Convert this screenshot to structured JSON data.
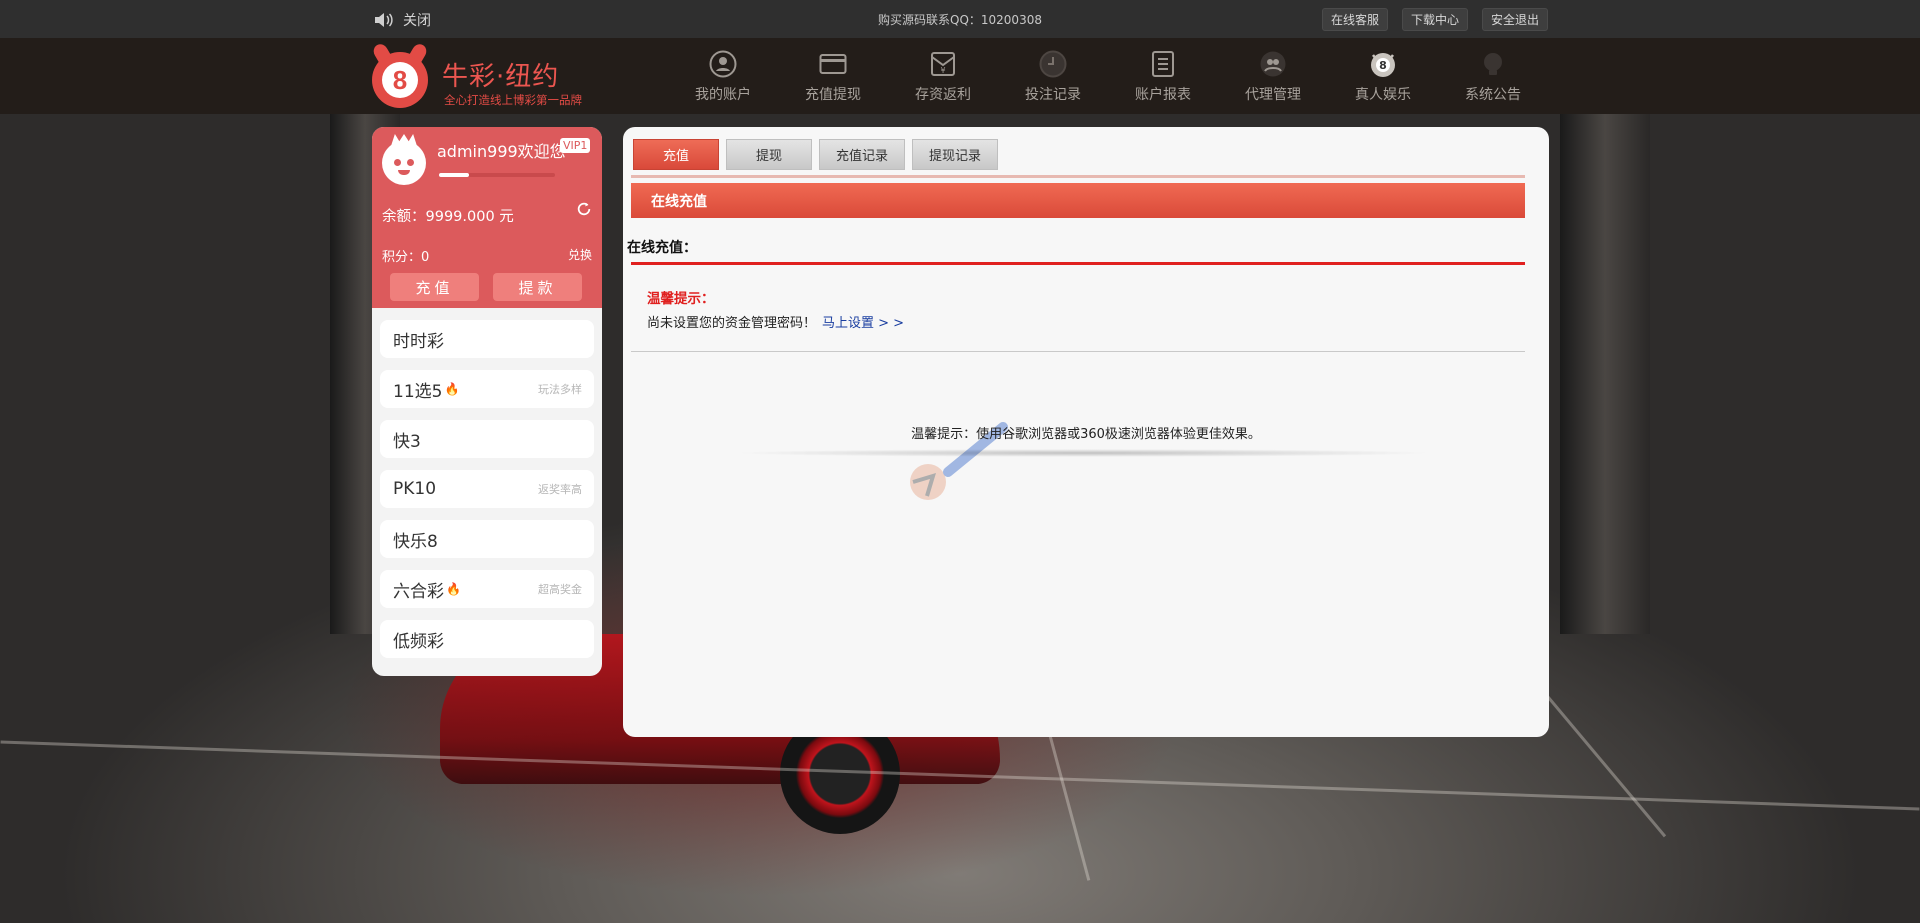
{
  "topbar": {
    "sound_label": "关闭",
    "contact": "购买源码联系QQ：10200308",
    "links": [
      "在线客服",
      "下载中心",
      "安全退出"
    ]
  },
  "logo": {
    "ball_digit": "8",
    "name": "牛彩·纽约",
    "slogan": "全心打造线上博彩第一品牌"
  },
  "nav": [
    {
      "label": "我的账户",
      "icon": "user-icon"
    },
    {
      "label": "充值提现",
      "icon": "card-icon"
    },
    {
      "label": "存资返利",
      "icon": "yen-envelope-icon"
    },
    {
      "label": "投注记录",
      "icon": "clock-icon"
    },
    {
      "label": "账户报表",
      "icon": "report-icon"
    },
    {
      "label": "代理管理",
      "icon": "agent-icon"
    },
    {
      "label": "真人娱乐",
      "icon": "eight-ball-icon"
    },
    {
      "label": "系统公告",
      "icon": "bulb-icon"
    }
  ],
  "user": {
    "welcome": "admin999欢迎您",
    "vip": "VIP1",
    "progress": 0.26,
    "balance": "余额：9999.000 元",
    "points": "积分：0",
    "exchange": "兑换",
    "deposit_button": "充值",
    "withdraw_button": "提款"
  },
  "games": [
    {
      "name": "时时彩",
      "tag": "",
      "hot": false
    },
    {
      "name": "11选5",
      "tag": "玩法多样",
      "hot": true
    },
    {
      "name": "快3",
      "tag": "",
      "hot": false
    },
    {
      "name": "PK10",
      "tag": "返奖率高",
      "hot": false
    },
    {
      "name": "快乐8",
      "tag": "",
      "hot": false
    },
    {
      "name": "六合彩",
      "tag": "超高奖金",
      "hot": true
    },
    {
      "name": "低频彩",
      "tag": "",
      "hot": false
    }
  ],
  "main": {
    "tabs": [
      "充值",
      "提现",
      "充值记录",
      "提现记录"
    ],
    "active_tab": 0,
    "section_title": "在线充值",
    "field_label": "在线充值：",
    "tip_title": "温馨提示：",
    "tip_text": "尚未设置您的资金管理密码！",
    "tip_link": "马上设置 > >",
    "browser_tip": "温馨提示：使用谷歌浏览器或360极速浏览器体验更佳效果。"
  },
  "colors": {
    "accent": "#dc5a5c",
    "tab_active": "#e0553f",
    "alert_red": "#e0201f",
    "link_blue": "#1a3ea0"
  }
}
